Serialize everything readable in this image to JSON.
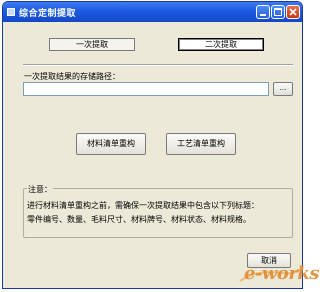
{
  "window": {
    "title": "综合定制提取"
  },
  "tabs": [
    {
      "label": "一次提取"
    },
    {
      "label": "二次提取"
    }
  ],
  "path": {
    "label": "一次提取结果的存储路径：",
    "value": "",
    "browse_label": "..."
  },
  "actions": {
    "material_label": "材料清单重构",
    "process_label": "工艺清单重构"
  },
  "note": {
    "title": "注意：",
    "line1": "进行材料清单重构之前，需确保一次提取结果中包含以下列标题：",
    "line2": "零件编号、数量、毛料尺寸、材料牌号、材料状态、材料规格。"
  },
  "footer": {
    "cancel_label": "取消"
  },
  "watermark": {
    "text": "e-works"
  },
  "colors": {
    "titlebar": "#1d5ae0",
    "window_bg": "#ece9d8",
    "close_button": "#c4381a",
    "watermark": "#e08a30"
  }
}
